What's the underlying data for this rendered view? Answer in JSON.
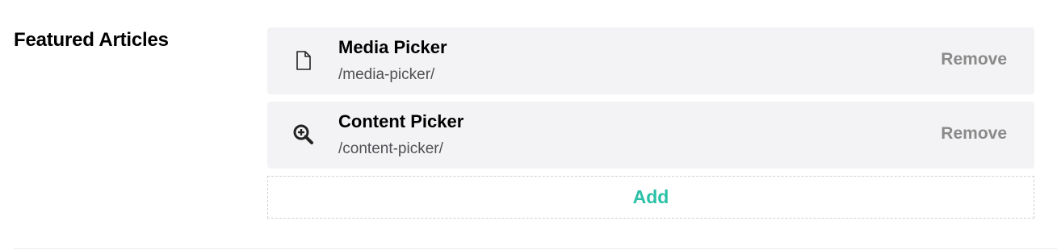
{
  "property": {
    "label": "Featured Articles"
  },
  "picker": {
    "items": [
      {
        "name": "Media Picker",
        "url": "/media-picker/",
        "icon": "document-icon",
        "remove_label": "Remove"
      },
      {
        "name": "Content Picker",
        "url": "/content-picker/",
        "icon": "zoom-in-icon",
        "remove_label": "Remove"
      }
    ],
    "add_label": "Add"
  },
  "colors": {
    "item_background": "#f3f3f5",
    "add_accent": "#2bc0a7",
    "remove_text": "#8a8a8a"
  }
}
